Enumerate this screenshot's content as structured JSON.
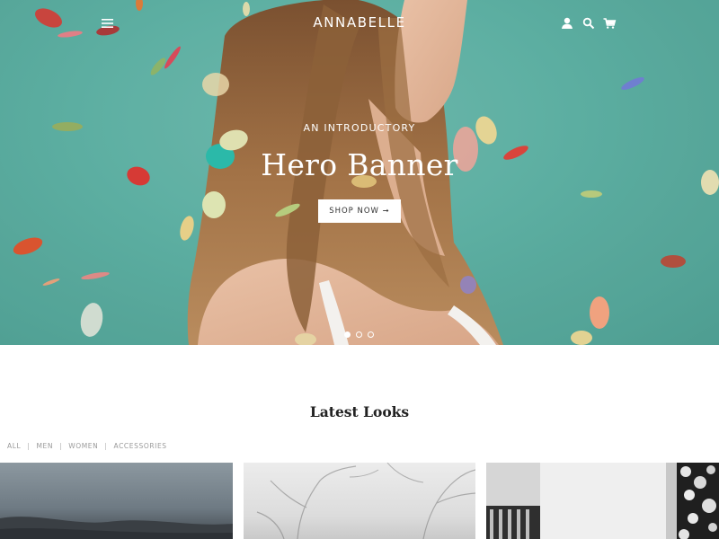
{
  "header": {
    "logo": "ANNABELLE",
    "menu_icon": "hamburger-menu-icon",
    "icons": [
      "account-icon",
      "search-icon",
      "cart-icon"
    ]
  },
  "hero": {
    "subtitle": "AN INTRODUCTORY",
    "title": "Hero Banner",
    "button_label": "SHOP NOW ➞",
    "slides": 3,
    "active_slide": 1,
    "background_color": "#5fb1a4"
  },
  "latest": {
    "title": "Latest Looks",
    "filters": [
      "ALL",
      "MEN",
      "WOMEN",
      "ACCESSORIES"
    ],
    "filter_separator": "|"
  }
}
